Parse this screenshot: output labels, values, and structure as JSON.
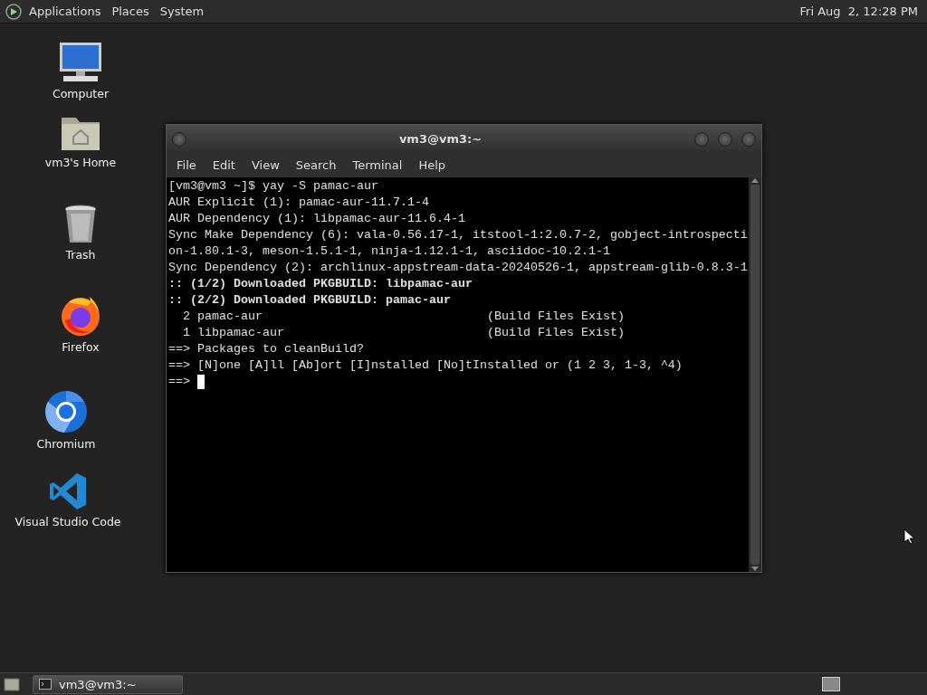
{
  "top_panel": {
    "menus": [
      "Applications",
      "Places",
      "System"
    ],
    "clock": "Fri Aug  2, 12:28 PM"
  },
  "desktop_icons": [
    {
      "kind": "computer",
      "label": "Computer"
    },
    {
      "kind": "home",
      "label": "vm3's Home"
    },
    {
      "kind": "trash",
      "label": "Trash"
    },
    {
      "kind": "firefox",
      "label": "Firefox"
    },
    {
      "kind": "chromium",
      "label": "Chromium"
    },
    {
      "kind": "vscode",
      "label": "Visual Studio Code"
    }
  ],
  "window": {
    "title": "vm3@vm3:~",
    "menu": [
      "File",
      "Edit",
      "View",
      "Search",
      "Terminal",
      "Help"
    ],
    "lines": [
      {
        "text": "[vm3@vm3 ~]$ yay -S pamac-aur",
        "bold": false
      },
      {
        "text": "AUR Explicit (1): pamac-aur-11.7.1-4",
        "bold": false
      },
      {
        "text": "AUR Dependency (1): libpamac-aur-11.6.4-1",
        "bold": false
      },
      {
        "text": "Sync Make Dependency (6): vala-0.56.17-1, itstool-1:2.0.7-2, gobject-introspecti",
        "bold": false
      },
      {
        "text": "on-1.80.1-3, meson-1.5.1-1, ninja-1.12.1-1, asciidoc-10.2.1-1",
        "bold": false
      },
      {
        "text": "Sync Dependency (2): archlinux-appstream-data-20240526-1, appstream-glib-0.8.3-1",
        "bold": false
      },
      {
        "text": ":: (1/2) Downloaded PKGBUILD: libpamac-aur",
        "bold": true
      },
      {
        "text": ":: (2/2) Downloaded PKGBUILD: pamac-aur",
        "bold": true
      },
      {
        "text": "  2 pamac-aur                               (Build Files Exist)",
        "bold": false
      },
      {
        "text": "  1 libpamac-aur                            (Build Files Exist)",
        "bold": false
      },
      {
        "text": "==> Packages to cleanBuild?",
        "bold": false
      },
      {
        "text": "==> [N]one [A]ll [Ab]ort [I]nstalled [No]tInstalled or (1 2 3, 1-3, ^4)",
        "bold": false
      },
      {
        "text": "==> ",
        "bold": false,
        "cursor": true
      }
    ]
  },
  "taskbar": {
    "tasks": [
      {
        "label": "vm3@vm3:~",
        "selected": true
      }
    ]
  }
}
